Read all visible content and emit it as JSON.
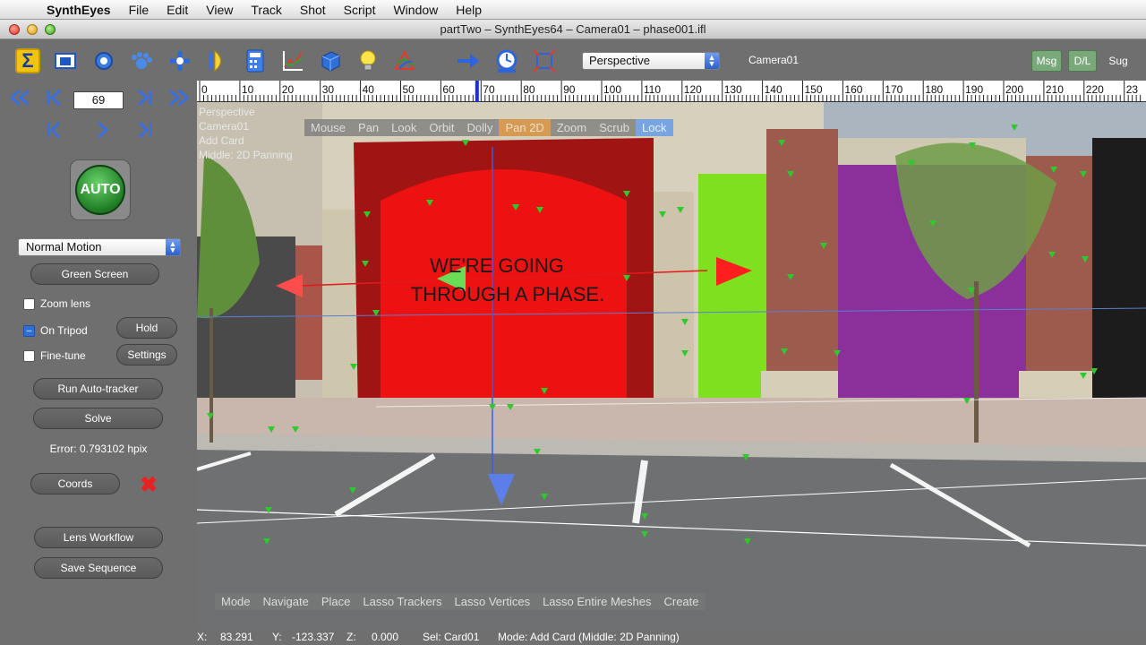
{
  "menubar": {
    "app_name": "SynthEyes",
    "items": [
      "File",
      "Edit",
      "View",
      "Track",
      "Shot",
      "Script",
      "Window",
      "Help"
    ]
  },
  "window": {
    "title": "partTwo – SynthEyes64 – Camera01 – phase001.ifl"
  },
  "toolbar": {
    "icons": [
      "summary-icon",
      "camera-view-icon",
      "feature-gear-icon",
      "tracker-paw-icon",
      "coords-icon",
      "lens-icon",
      "calculator-icon",
      "graph-icon",
      "3d-cube-icon",
      "light-bulb-icon",
      "phase-icon",
      "move-arrow-icon",
      "clock-icon",
      "crop-icon"
    ],
    "view_select": "Perspective",
    "camera_label": "Camera01",
    "msg_label": "Msg",
    "dl_label": "D/L",
    "sug_label": "Sug"
  },
  "timeline": {
    "current_frame": "69",
    "ticks": [
      "0",
      "10",
      "20",
      "30",
      "40",
      "50",
      "60",
      "70",
      "80",
      "90",
      "100",
      "110",
      "120",
      "130",
      "140",
      "150",
      "160",
      "170",
      "180",
      "190",
      "200",
      "210",
      "220",
      "23"
    ]
  },
  "left_panel": {
    "auto_label": "AUTO",
    "motion_select": "Normal Motion",
    "green_screen": "Green Screen",
    "zoom_lens": "Zoom lens",
    "on_tripod": "On Tripod",
    "hold": "Hold",
    "fine_tune": "Fine-tune",
    "settings": "Settings",
    "run_autotracker": "Run Auto-tracker",
    "solve": "Solve",
    "error": "Error: 0.793102 hpix",
    "coords": "Coords",
    "lens_workflow": "Lens Workflow",
    "save_sequence": "Save Sequence"
  },
  "viewport": {
    "info": [
      "Perspective",
      "Camera01",
      "Add Card",
      "Middle: 2D Panning"
    ],
    "mouse_modes": [
      "Mouse",
      "Pan",
      "Look",
      "Orbit",
      "Dolly",
      "Pan 2D",
      "Zoom",
      "Scrub",
      "Lock"
    ],
    "edit_modes": [
      "Mode",
      "Navigate",
      "Place",
      "Lasso Trackers",
      "Lasso Vertices",
      "Lasso Entire Meshes",
      "Create"
    ],
    "sign_text": [
      "WE'RE GOING",
      "THROUGH A PHASE."
    ]
  },
  "statusbar": {
    "x_label": "X:",
    "x_value": "83.291",
    "y_label": "Y:",
    "y_value": "-123.337",
    "z_label": "Z:",
    "z_value": "0.000",
    "sel": "Sel: Card01",
    "mode": "Mode: Add Card (Middle: 2D Panning)"
  },
  "colors": {
    "accent_blue": "#2f6fd8",
    "tracker_green": "#2ec92e",
    "door_red": "#ee1111"
  }
}
